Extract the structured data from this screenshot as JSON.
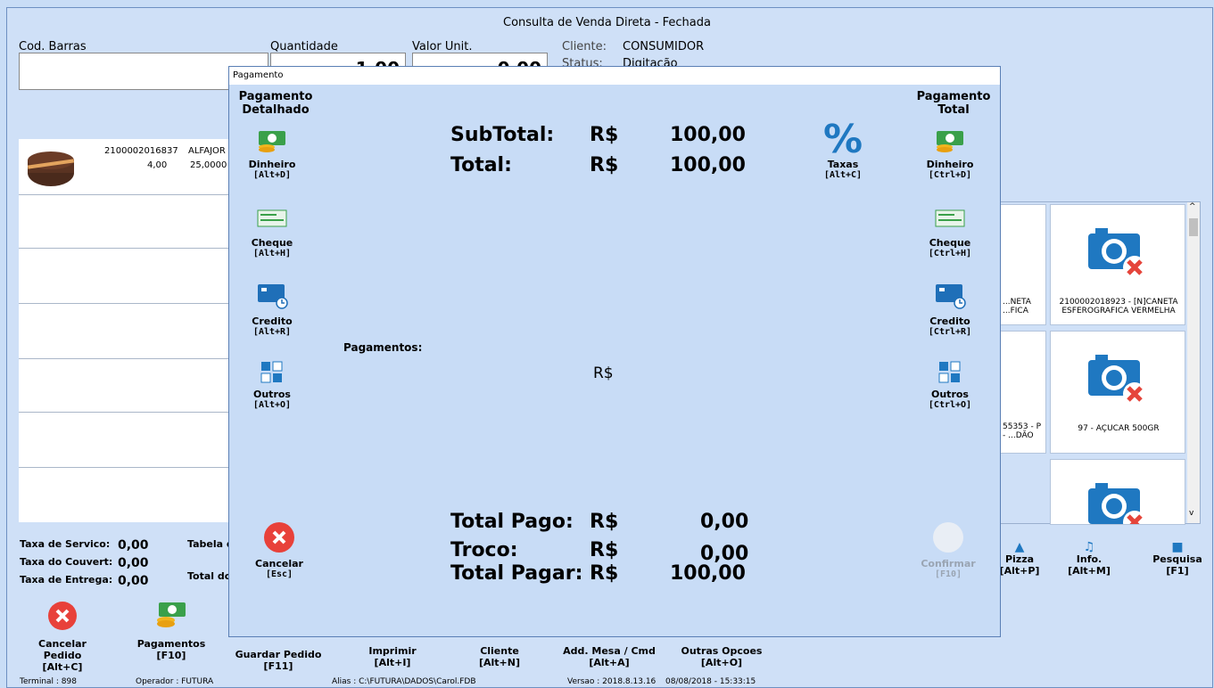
{
  "window": {
    "title": "Consulta de Venda Direta - Fechada"
  },
  "entry": {
    "barcode_label": "Cod. Barras",
    "quantity_label": "Quantidade",
    "quantity_value": "1,00",
    "unit_value_label": "Valor Unit.",
    "unit_value": "0,00",
    "client_label": "Cliente:",
    "client_value": "CONSUMIDOR",
    "status_label": "Status:",
    "status_value": "Digitação"
  },
  "item": {
    "code": "2100002016837",
    "name": "ALFAJOR",
    "qty": "4,00",
    "price": "25,0000"
  },
  "products": [
    {
      "label": "2100002018923 - [N]CANETA ESFEROGRAFICA VERMELHA"
    },
    {
      "label": "97 - AÇUCAR 500GR"
    }
  ],
  "partial_products": [
    {
      "label": "...NETA ...FICA"
    },
    {
      "label": "55353 - P - ...DÃO"
    }
  ],
  "fees": {
    "service_label": "Taxa de Servico:",
    "service_value": "0,00",
    "couvert_label": "Taxa do Couvert:",
    "couvert_value": "0,00",
    "delivery_label": "Taxa de Entrega:",
    "delivery_value": "0,00",
    "table_label": "Tabela d",
    "total_label": "Total do"
  },
  "right_buttons": [
    {
      "label": "Pizza",
      "key": "[Alt+P]"
    },
    {
      "label": "Info.",
      "key": "[Alt+M]"
    },
    {
      "label": "Pesquisa",
      "key": "[F1]"
    }
  ],
  "bottom_buttons": [
    {
      "label": "Cancelar Pedido",
      "key": "[Alt+C]"
    },
    {
      "label": "Pagamentos",
      "key": "[F10]"
    },
    {
      "label": "Guardar Pedido",
      "key": "[F11]"
    },
    {
      "label": "Imprimir",
      "key": "[Alt+I]"
    },
    {
      "label": "Cliente",
      "key": "[Alt+N]"
    },
    {
      "label": "Add. Mesa / Cmd",
      "key": "[Alt+A]"
    },
    {
      "label": "Outras Opcoes",
      "key": "[Alt+O]"
    }
  ],
  "statusbar": {
    "terminal": "Terminal : 898",
    "operator": "Operador : FUTURA",
    "alias": "Alias : C:\\FUTURA\\DADOS\\Carol.FDB",
    "version": "Versao : 2018.8.13.16",
    "datetime": "08/08/2018 - 15:33:15"
  },
  "dialog": {
    "title": "Pagamento",
    "left_header": "Pagamento Detalhado",
    "right_header": "Pagamento Total",
    "subtotal_label": "SubTotal:",
    "total_label": "Total:",
    "currency": "R$",
    "subtotal_value": "100,00",
    "total_value": "100,00",
    "taxas_label": "Taxas",
    "taxas_key": "[Alt+C]",
    "pagamentos_label": "Pagamentos:",
    "pagamentos_currency": "R$",
    "left_options": [
      {
        "label": "Dinheiro",
        "key": "[Alt+D]"
      },
      {
        "label": "Cheque",
        "key": "[Alt+H]"
      },
      {
        "label": "Credito",
        "key": "[Alt+R]"
      },
      {
        "label": "Outros",
        "key": "[Alt+O]"
      }
    ],
    "right_options": [
      {
        "label": "Dinheiro",
        "key": "[Ctrl+D]"
      },
      {
        "label": "Cheque",
        "key": "[Ctrl+H]"
      },
      {
        "label": "Credito",
        "key": "[Ctrl+R]"
      },
      {
        "label": "Outros",
        "key": "[Ctrl+O]"
      }
    ],
    "total_pago_label": "Total Pago:",
    "total_pago_value": "0,00",
    "troco_label": "Troco:",
    "troco_value": "0,00",
    "total_pagar_label": "Total Pagar:",
    "total_pagar_value": "100,00",
    "cancel_label": "Cancelar",
    "cancel_key": "[Esc]",
    "confirm_label": "Confirmar",
    "confirm_key": "[F10]"
  },
  "colors": {
    "accent": "#2a7fc8",
    "cancel_red": "#e8413a",
    "money_green": "#3aa04a"
  }
}
